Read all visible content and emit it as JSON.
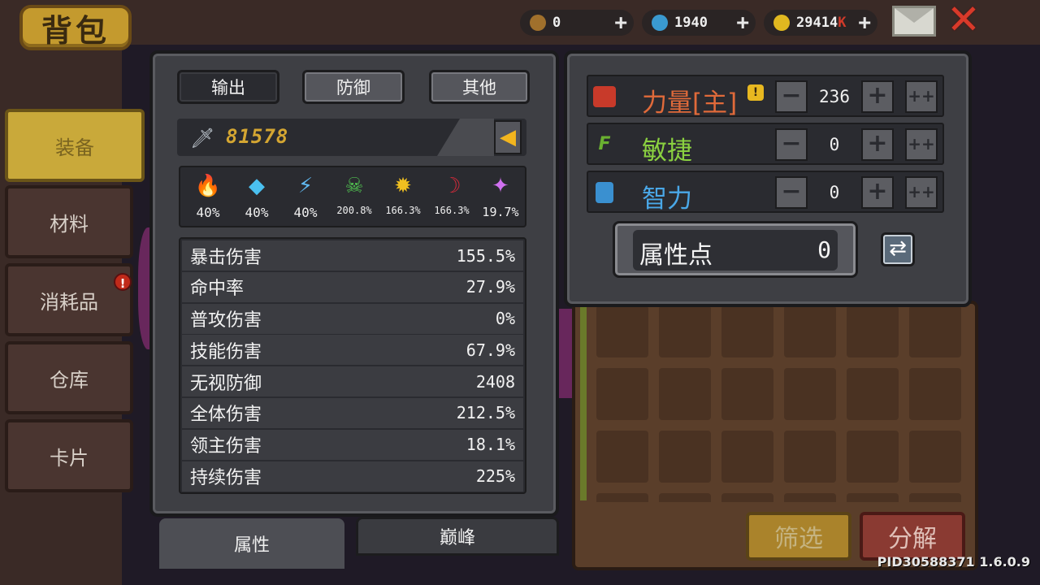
{
  "header": {
    "title": "背包"
  },
  "currencies": [
    {
      "name": "key",
      "value": "0",
      "plus": "+",
      "color": "#a0702c"
    },
    {
      "name": "gem",
      "value": "1940",
      "plus": "+",
      "color": "#3a9ad0"
    },
    {
      "name": "coin",
      "value": "29414",
      "suffix": "K",
      "plus": "+",
      "color": "#e0b820"
    }
  ],
  "top_icons": {
    "mail": "mail-icon",
    "close": "close-icon",
    "close_glyph": "✕"
  },
  "left_tabs": [
    {
      "label": "装备",
      "active": true
    },
    {
      "label": "材料"
    },
    {
      "label": "消耗品",
      "badge": "!"
    },
    {
      "label": "仓库"
    },
    {
      "label": "卡片"
    }
  ],
  "stat_tabs": [
    "输出",
    "防御",
    "其他"
  ],
  "power": {
    "value": "81578",
    "sword_glyph": "🗡",
    "arrow_glyph": "◀"
  },
  "elements": [
    {
      "icon": "fire-icon",
      "glyph": "🔥",
      "value": "40%",
      "color": "#f07a20"
    },
    {
      "icon": "ice-icon",
      "glyph": "◆",
      "value": "40%",
      "color": "#4ac0f0"
    },
    {
      "icon": "lightning-icon",
      "glyph": "⚡",
      "value": "40%",
      "color": "#60b8f0"
    },
    {
      "icon": "poison-icon",
      "glyph": "☠",
      "value": "200.8%",
      "color": "#50c050"
    },
    {
      "icon": "light-icon",
      "glyph": "✹",
      "value": "166.3%",
      "color": "#f0c020"
    },
    {
      "icon": "dark-icon",
      "glyph": "☽",
      "value": "166.3%",
      "color": "#d02a3a"
    },
    {
      "icon": "arcane-icon",
      "glyph": "✦",
      "value": "19.7%",
      "color": "#d070f0"
    }
  ],
  "stats": [
    {
      "label": "暴击伤害",
      "value": "155.5%"
    },
    {
      "label": "命中率",
      "value": "27.9%"
    },
    {
      "label": "普攻伤害",
      "value": "0%"
    },
    {
      "label": "技能伤害",
      "value": "67.9%"
    },
    {
      "label": "无视防御",
      "value": "2408"
    },
    {
      "label": "全体伤害",
      "value": "212.5%"
    },
    {
      "label": "领主伤害",
      "value": "18.1%"
    },
    {
      "label": "持续伤害",
      "value": "225%"
    }
  ],
  "bottom_tabs": {
    "active": "属性",
    "inactive": "巅峰"
  },
  "attributes": [
    {
      "name": "力量[主]",
      "value": "236",
      "color": "#e06a3a",
      "icon": "fist-icon",
      "icon_color": "#c83a2a",
      "info": "!"
    },
    {
      "name": "敏捷",
      "value": "0",
      "color": "#8ad040",
      "icon": "feather-icon",
      "icon_color": "#6ab030"
    },
    {
      "name": "智力",
      "value": "0",
      "color": "#4aa8e8",
      "icon": "book-icon",
      "icon_color": "#3a90d0"
    }
  ],
  "attr_buttons": {
    "minus": "−",
    "plus": "+",
    "plus10": "++"
  },
  "points": {
    "label": "属性点",
    "value": "0",
    "refresh_glyph": "⇄"
  },
  "inventory_buttons": {
    "filter": "筛选",
    "decompose": "分解"
  },
  "version": "PID30588371 1.6.0.9"
}
